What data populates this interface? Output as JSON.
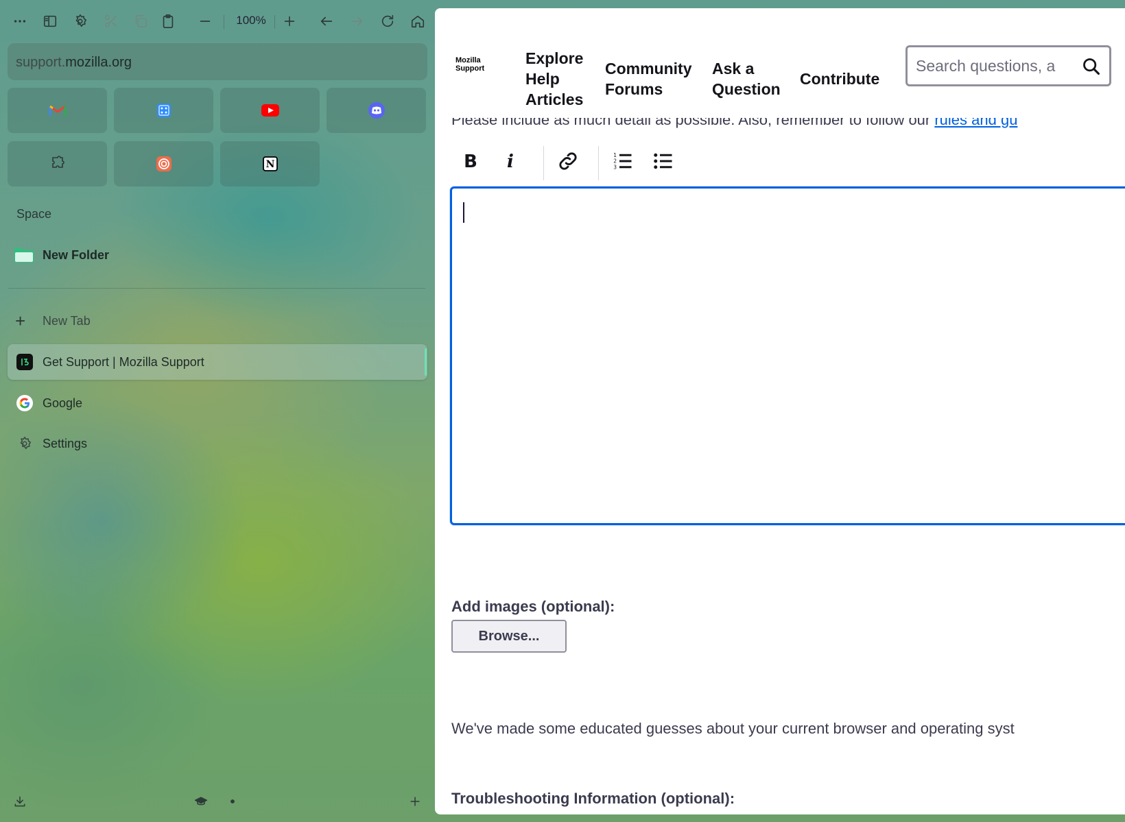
{
  "toolbar": {
    "zoom": "100%",
    "icons": [
      "more-icon",
      "sidebar-toggle-icon",
      "settings-icon",
      "scissors-icon",
      "copy-icon",
      "clipboard-icon",
      "zoom-out-icon",
      "zoom-in-icon",
      "back-icon",
      "forward-icon",
      "reload-icon",
      "home-icon"
    ]
  },
  "urlbar": {
    "subdomain": "support.",
    "domain": "mozilla.org"
  },
  "pinned": [
    {
      "name": "Gmail",
      "icon": "gmail-icon",
      "color": "#ea4335"
    },
    {
      "name": "Dice",
      "icon": "dice-icon",
      "color": "#2d8cff"
    },
    {
      "name": "YouTube",
      "icon": "youtube-icon",
      "color": "#ff0000"
    },
    {
      "name": "Discord",
      "icon": "discord-icon",
      "color": "#5865f2"
    },
    {
      "name": "Extension",
      "icon": "puzzle-icon",
      "color": "#3a4a45"
    },
    {
      "name": "Target",
      "icon": "target-icon",
      "color": "#ef6c4a"
    },
    {
      "name": "Notion",
      "icon": "notion-icon",
      "color": "#000000"
    }
  ],
  "sidebar": {
    "space_label": "Space",
    "folder_label": "New Folder",
    "new_tab_label": "New Tab",
    "tabs": [
      {
        "label": "Get Support | Mozilla Support",
        "icon": "mozilla-support-icon",
        "active": true
      },
      {
        "label": "Google",
        "icon": "google-icon",
        "active": false
      },
      {
        "label": "Settings",
        "icon": "settings-icon",
        "active": false
      }
    ]
  },
  "site": {
    "logo_line1": "Mozilla",
    "logo_line2": "Support",
    "nav": {
      "explore_1": "Explore",
      "explore_2": "Help",
      "explore_3": "Articles",
      "forums_1": "Community",
      "forums_2": "Forums",
      "ask_1": "Ask a",
      "ask_2": "Question",
      "contribute": "Contribute"
    },
    "search_placeholder": "Search questions, a",
    "intro_text": "Please include as much detail as possible. Also, remember to follow our ",
    "intro_link": "rules and gu",
    "editor_tools": [
      "bold",
      "italic",
      "link",
      "numbered-list",
      "bulleted-list"
    ],
    "editor_value": "",
    "images_label": "Add images (optional):",
    "browse_label": "Browse...",
    "guess_text": "We've made some educated guesses about your current browser and operating syst",
    "troubleshooting_label": "Troubleshooting Information (optional):"
  },
  "colors": {
    "accent": "#0060df",
    "active_tab_bar": "#6de0b6"
  }
}
